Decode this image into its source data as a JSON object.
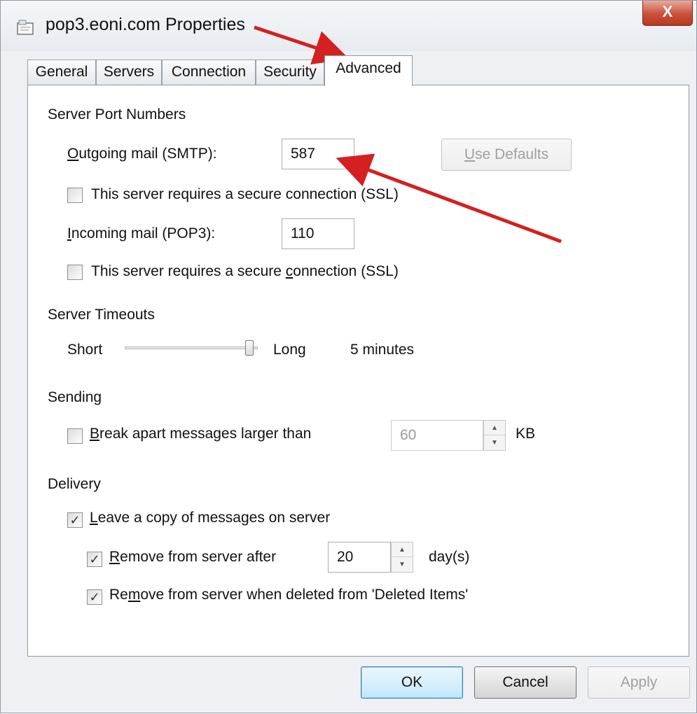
{
  "window": {
    "title": "pop3.eoni.com Properties",
    "close_glyph": "X",
    "title_icon": "mail-account-icon"
  },
  "tabs": [
    {
      "label": "General"
    },
    {
      "label": "Servers"
    },
    {
      "label": "Connection"
    },
    {
      "label": "Security"
    },
    {
      "label": "Advanced",
      "active": true
    }
  ],
  "server_ports": {
    "heading": "Server Port Numbers",
    "outgoing_label_pre": "",
    "outgoing_label_key": "O",
    "outgoing_label_post": "utgoing mail (SMTP):",
    "outgoing_value": "587",
    "use_defaults_key": "U",
    "use_defaults_post": "se Defaults",
    "outgoing_ssl_label": "This server requires a secure connection (SSL)",
    "incoming_label_key": "I",
    "incoming_label_post": "ncoming mail (POP3):",
    "incoming_value": "110",
    "incoming_ssl_pre": "This server requires a secure ",
    "incoming_ssl_key": "c",
    "incoming_ssl_post": "onnection (SSL)"
  },
  "timeouts": {
    "heading": "Server Timeouts",
    "short_label": "Short",
    "long_label": "Long",
    "value_text": "5 minutes",
    "slider_level": 1.0
  },
  "sending": {
    "heading": "Sending",
    "break_key": "B",
    "break_post": "reak apart messages larger than",
    "size_value": "60",
    "unit": "KB"
  },
  "delivery": {
    "heading": "Delivery",
    "leave_copy_key": "L",
    "leave_copy_post": "eave a copy of messages on server",
    "remove_after_key": "R",
    "remove_after_post": "emove from server after",
    "days_value": "20",
    "days_unit": "day(s)",
    "remove_deleted_pre": "Re",
    "remove_deleted_key": "m",
    "remove_deleted_post": "ove from server when deleted from 'Deleted Items'",
    "check_glyph": "✓"
  },
  "buttons": {
    "ok": "OK",
    "cancel": "Cancel",
    "apply": "Apply"
  },
  "colors": {
    "annotation_arrow": "#d42020",
    "default_button": "#3c7fb1"
  }
}
